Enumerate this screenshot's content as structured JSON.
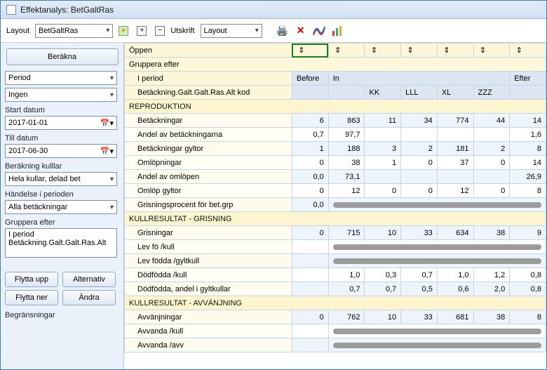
{
  "window_title": "Effektanalys: BetGaltRas",
  "toolbar": {
    "layout_label": "Layout",
    "layout_value": "BetGaltRas",
    "utskrift_label": "Utskrift",
    "utskrift_sub": "Layout"
  },
  "sidebar": {
    "calc_btn": "Beräkna",
    "period_dd": "Period",
    "ingen_dd": "Ingen",
    "start_label": "Start datum",
    "start_value": "2017-01-01",
    "till_label": "Till datum",
    "till_value": "2017-06-30",
    "berakning_label": "Beräkning kulllar",
    "berakning_value": "Hela kullar, delad bet",
    "handelse_label": "Händelse i perioden",
    "handelse_value": "Alla betäckningar",
    "gruppera_label": "Gruppera efter",
    "gruppera_items": "I period\nBetäckning.Galt.Galt.Ras.Alt",
    "flytta_upp": "Flytta upp",
    "alternativ": "Alternativ",
    "flytta_ner": "Flytta ner",
    "andra": "Ändra",
    "begransningar": "Begränsningar"
  },
  "grid": {
    "oppen": "Öppen",
    "gruppera_efter": "Gruppera efter",
    "i_period": "I period",
    "before": "Before",
    "in": "In",
    "efter": "Efter",
    "betackning_key": "Betäckning.Galt.Galt.Ras.Alt kod",
    "cols": {
      "kk": "KK",
      "lll": "LLL",
      "xl": "XL",
      "zzz": "ZZZ"
    },
    "sec_reproduktion": "REPRODUKTION",
    "sec_kullgris": "KULLRESULTAT - GRISNING",
    "sec_kullavv": "KULLRESULTAT - AVVÄNJNING",
    "rows": {
      "betackningar": {
        "label": "Betäckningar",
        "v": [
          "6",
          "863",
          "11",
          "34",
          "774",
          "44",
          "14"
        ]
      },
      "andel_bet": {
        "label": "Andel av betäckningarna",
        "v": [
          "0,7",
          "97,7",
          "",
          "",
          "",
          "",
          "1,6"
        ]
      },
      "bet_gyltor": {
        "label": "Betäckningar gyltor",
        "v": [
          "1",
          "188",
          "3",
          "2",
          "181",
          "2",
          "8"
        ]
      },
      "omlop": {
        "label": "Omlöpningar",
        "v": [
          "0",
          "38",
          "1",
          "0",
          "37",
          "0",
          "14"
        ]
      },
      "andel_oml": {
        "label": "Andel av omlöpen",
        "v": [
          "0,0",
          "73,1",
          "",
          "",
          "",
          "",
          "26,9"
        ]
      },
      "omlop_gyltor": {
        "label": "Omlöp gyltor",
        "v": [
          "0",
          "12",
          "0",
          "0",
          "12",
          "0",
          "8"
        ]
      },
      "grisproc": {
        "label": "Grisningsprocent för bet.grp",
        "v": [
          "0,0",
          "",
          "",
          "",
          "",
          "",
          ""
        ]
      },
      "grisningar": {
        "label": "Grisningar",
        "v": [
          "0",
          "715",
          "10",
          "33",
          "634",
          "38",
          "9"
        ]
      },
      "levfo_kull": {
        "label": "Lev fö /kull"
      },
      "levfodda_gylt": {
        "label": "Lev födda /gyltkull"
      },
      "dodfodda_kull": {
        "label": "Dödfödda /kull",
        "v": [
          "",
          "1,0",
          "0,3",
          "0,7",
          "1,0",
          "1,2",
          "0,8"
        ]
      },
      "dodfodda_gylt": {
        "label": "Dödfödda, andel i gyltkullar",
        "v": [
          "",
          "0,7",
          "0,7",
          "0,5",
          "0,6",
          "2,0",
          "0,8"
        ]
      },
      "avvanjningar": {
        "label": "Avvänjningar",
        "v": [
          "0",
          "762",
          "10",
          "33",
          "681",
          "38",
          "8"
        ]
      },
      "avvanda_kull": {
        "label": "Avvanda /kull"
      },
      "avvanda_avv": {
        "label": "Avvanda /avv"
      }
    }
  }
}
